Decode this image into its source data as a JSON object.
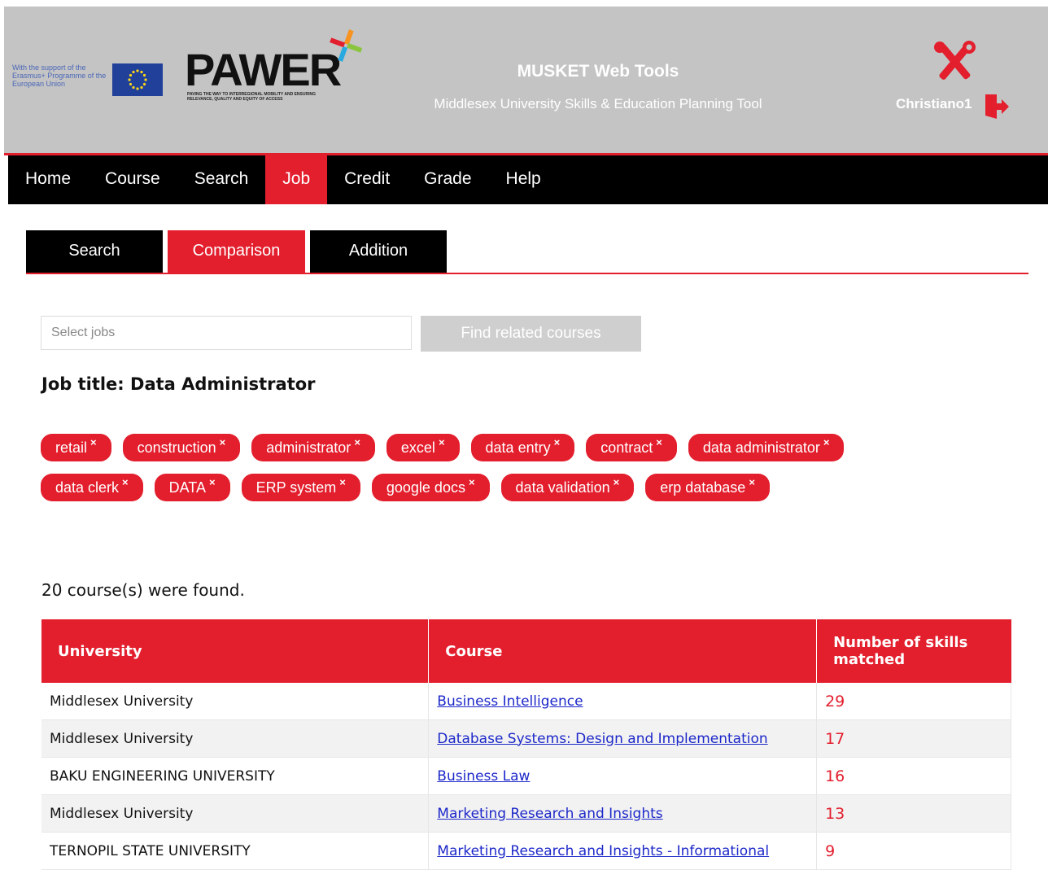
{
  "header": {
    "eu_support_text": "With the support of the Erasmus+ Programme of the European Union",
    "logo_text": "PAWER",
    "logo_subtitle": "PAVING THE WAY TO INTERREGIONAL MOBILITY AND ENSURING RELEVANCE, QUALITY AND EQUITY OF ACCESS",
    "title": "MUSKET Web Tools",
    "subtitle": "Middlesex University Skills & Education Planning Tool",
    "username": "Christiano1"
  },
  "nav": {
    "items": [
      {
        "label": "Home"
      },
      {
        "label": "Course"
      },
      {
        "label": "Search"
      },
      {
        "label": "Job"
      },
      {
        "label": "Credit"
      },
      {
        "label": "Grade"
      },
      {
        "label": "Help"
      }
    ],
    "active": "Job"
  },
  "subtabs": {
    "items": [
      {
        "label": "Search"
      },
      {
        "label": "Comparison"
      },
      {
        "label": "Addition"
      }
    ],
    "active": "Comparison"
  },
  "job_search": {
    "placeholder": "Select jobs",
    "button_label": "Find related courses"
  },
  "job_title": {
    "label": "Job title: Data Administrator"
  },
  "tags": {
    "row1": [
      "retail",
      "construction",
      "administrator",
      "excel",
      "data entry",
      "contract",
      "data administrator"
    ],
    "row2": [
      "data clerk",
      "DATA",
      "ERP system",
      "google docs",
      "data validation",
      "erp database"
    ],
    "remove_glyph": "×"
  },
  "results": {
    "summary": "20 course(s) were found.",
    "columns": [
      "University",
      "Course",
      "Number of skills matched"
    ],
    "rows": [
      {
        "university": "Middlesex University",
        "course": "Business Intelligence",
        "count": "29"
      },
      {
        "university": "Middlesex University",
        "course": "Database Systems: Design and Implementation",
        "count": "17"
      },
      {
        "university": "BAKU ENGINEERING UNIVERSITY",
        "course": "Business Law",
        "count": "16"
      },
      {
        "university": "Middlesex University",
        "course": "Marketing Research and Insights",
        "count": "13"
      },
      {
        "university": "TERNOPIL STATE UNIVERSITY",
        "course": "Marketing Research and Insights - Informational",
        "count": "9"
      }
    ]
  },
  "colors": {
    "accent": "#e31e2d",
    "header_bg": "#c4c4c4",
    "nav_bg": "#000000",
    "link": "#1d28c9"
  }
}
